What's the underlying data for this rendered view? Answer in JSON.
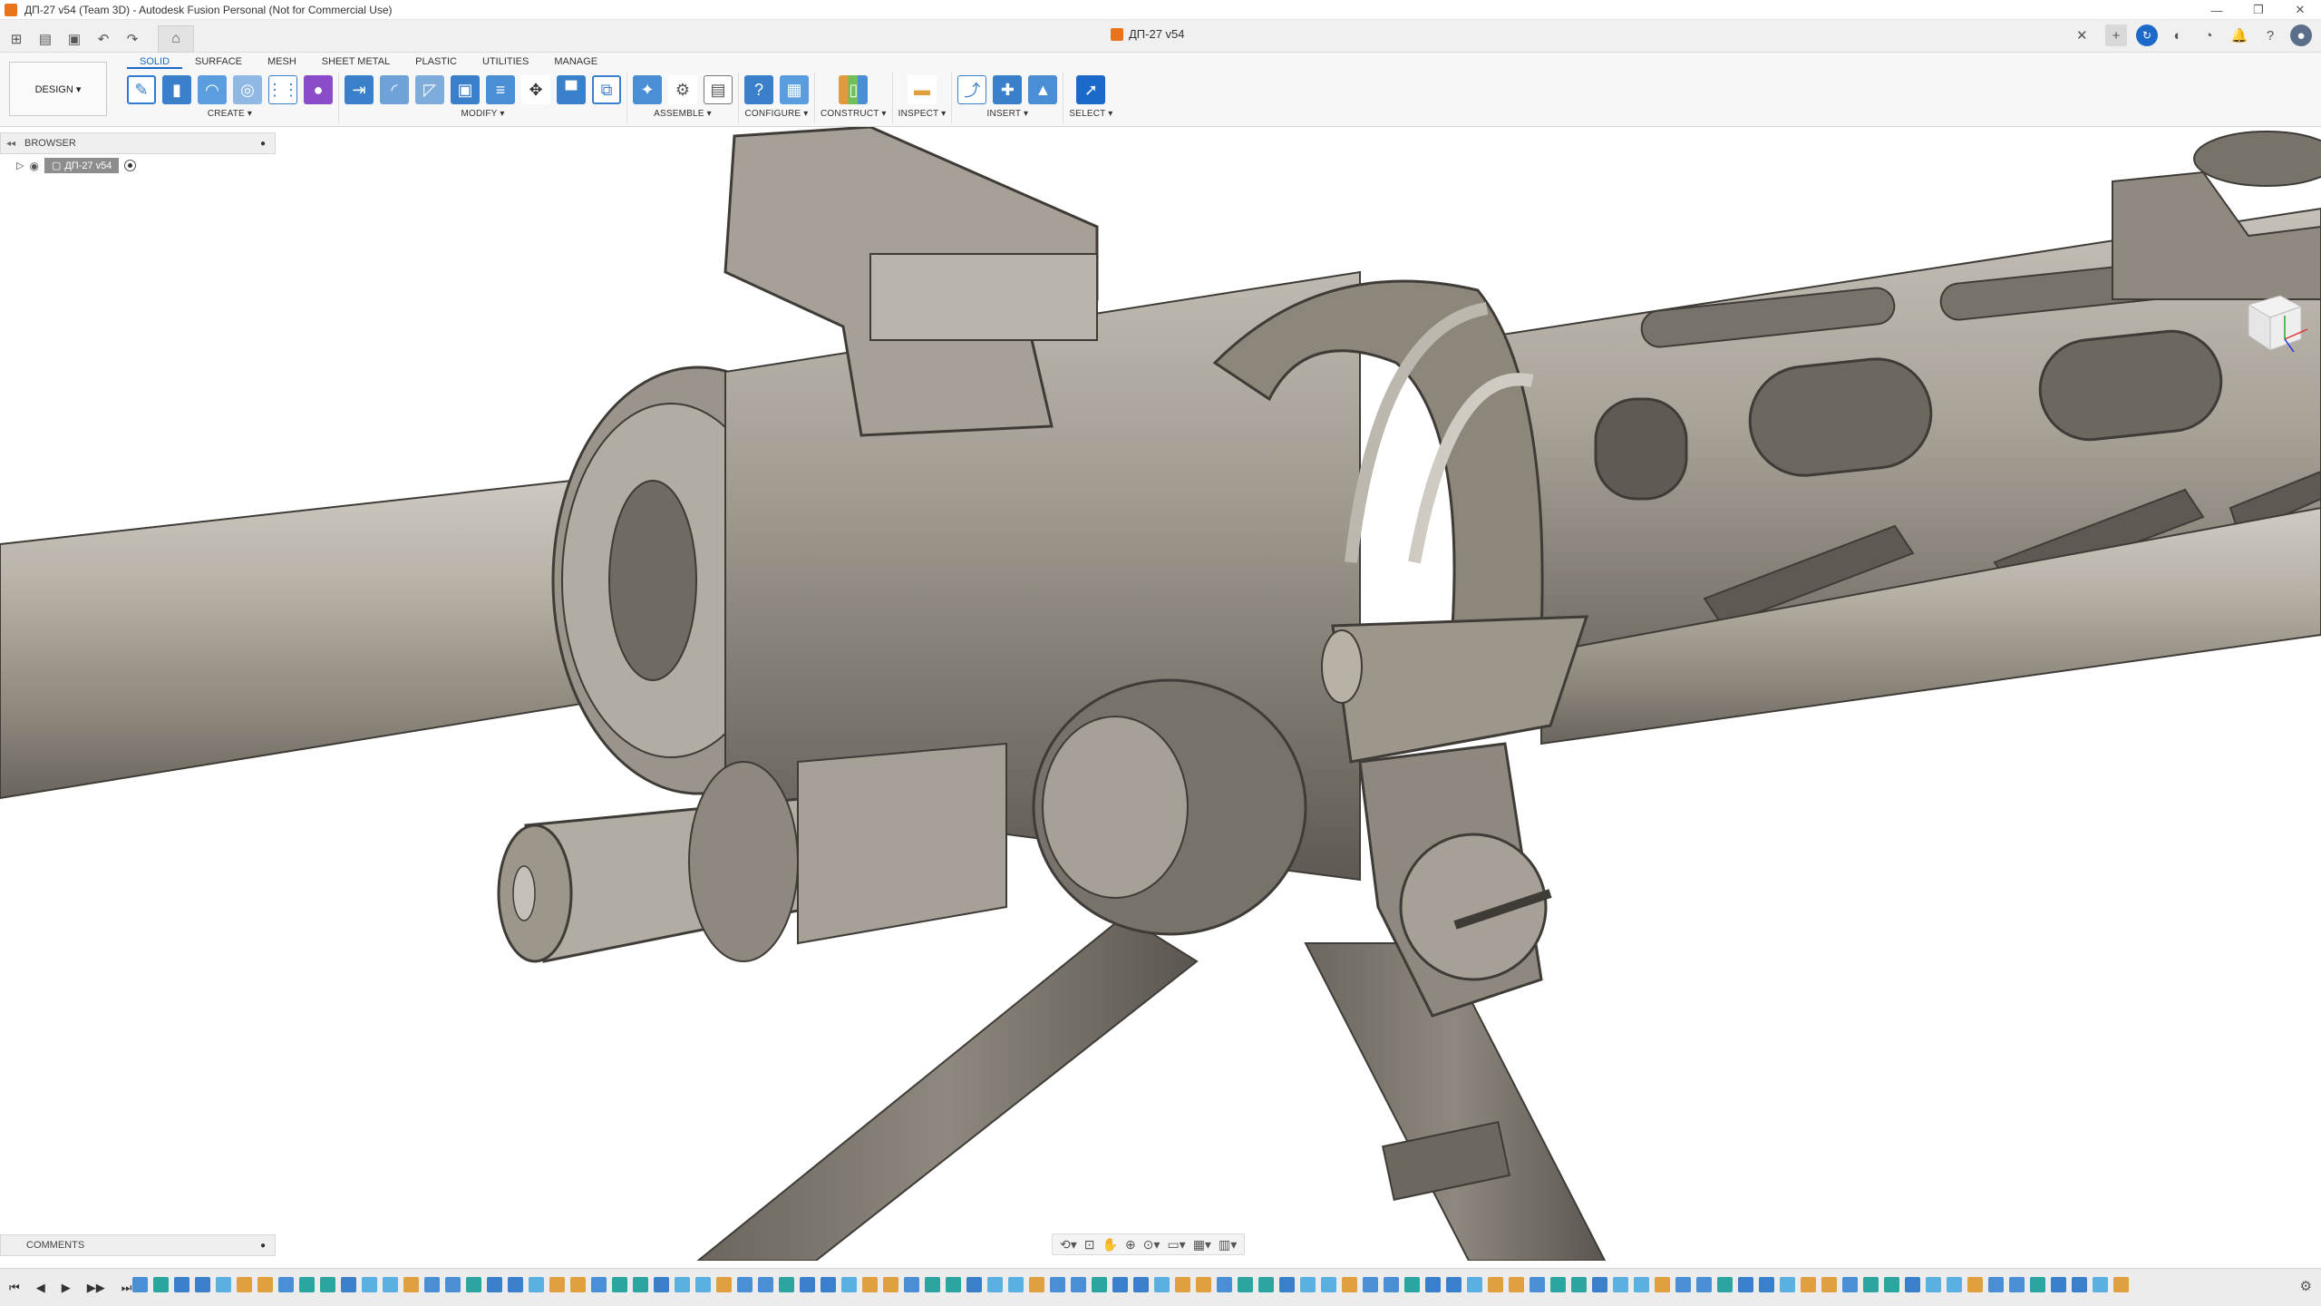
{
  "window": {
    "title": "ДП-27 v54 (Team 3D) - Autodesk Fusion Personal (Not for Commercial Use)",
    "controls": [
      "—",
      "❐",
      "✕"
    ]
  },
  "document": {
    "tab_title": "ДП-27 v54",
    "close_glyph": "✕"
  },
  "workspace": {
    "label": "DESIGN ▾"
  },
  "ribbon": {
    "tabs": [
      "SOLID",
      "SURFACE",
      "MESH",
      "SHEET METAL",
      "PLASTIC",
      "UTILITIES",
      "MANAGE"
    ],
    "active_tab": "SOLID",
    "groups": [
      {
        "label": "CREATE ▾",
        "icons": [
          "sketch-icon",
          "extrude-icon",
          "revolve-icon",
          "hole-icon",
          "pattern-icon",
          "form-icon"
        ]
      },
      {
        "label": "MODIFY ▾",
        "icons": [
          "press-pull-icon",
          "fillet-icon",
          "chamfer-icon",
          "shell-icon",
          "combine-icon",
          "move-icon",
          "align-icon",
          "scale-icon"
        ]
      },
      {
        "label": "ASSEMBLE ▾",
        "icons": [
          "new-component-icon",
          "joint-icon",
          "table-icon"
        ]
      },
      {
        "label": "CONFIGURE ▾",
        "icons": [
          "configure-icon",
          "parameters-icon"
        ]
      },
      {
        "label": "CONSTRUCT ▾",
        "icons": [
          "plane-icon"
        ]
      },
      {
        "label": "INSPECT ▾",
        "icons": [
          "measure-icon"
        ]
      },
      {
        "label": "INSERT ▾",
        "icons": [
          "insert-derive-icon",
          "insert-mesh-icon",
          "decal-icon"
        ]
      },
      {
        "label": "SELECT ▾",
        "icons": [
          "select-icon"
        ]
      }
    ]
  },
  "browser": {
    "header": "BROWSER",
    "collapse_glyph": "◂◂",
    "pin_glyph": "●",
    "root_node": "ДП-27 v54"
  },
  "comments": {
    "header": "COMMENTS",
    "pin_glyph": "●"
  },
  "nav_toolbar": {
    "icons": [
      "orbit-icon",
      "look-at-icon",
      "pan-icon",
      "zoom-icon",
      "fit-icon",
      "display-settings-icon",
      "grid-icon"
    ]
  },
  "timeline": {
    "playback": [
      "⏮",
      "◀",
      "▶",
      "▶▶",
      "⏭"
    ],
    "feature_count": 96,
    "colors": {
      "sketch": "#4a8fd6",
      "extrude": "#3a7fc9",
      "fillet": "#e0a040",
      "pattern": "#2aa5a0",
      "construct": "#5ab0e0"
    }
  },
  "colors": {
    "accent": "#1b6ac9",
    "model_steel": "#8a8478",
    "model_highlight": "#c9c5bd",
    "model_shadow": "#54504a",
    "orange": "#e8731a"
  }
}
